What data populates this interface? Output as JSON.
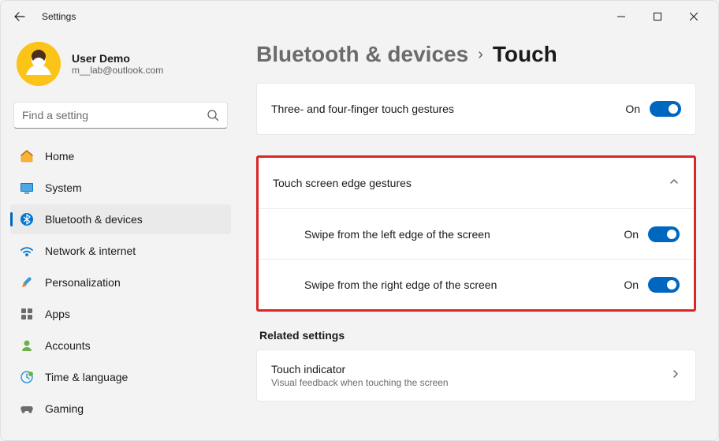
{
  "window": {
    "title": "Settings"
  },
  "profile": {
    "name": "User Demo",
    "email": "m__lab@outlook.com"
  },
  "search": {
    "placeholder": "Find a setting"
  },
  "nav": {
    "home": "Home",
    "system": "System",
    "bluetooth": "Bluetooth & devices",
    "network": "Network & internet",
    "personalization": "Personalization",
    "apps": "Apps",
    "accounts": "Accounts",
    "time": "Time & language",
    "gaming": "Gaming"
  },
  "breadcrumb": {
    "parent": "Bluetooth & devices",
    "current": "Touch"
  },
  "settings": {
    "gestures34": {
      "label": "Three- and four-finger touch gestures",
      "status": "On"
    },
    "edgeGestures": {
      "header": "Touch screen edge gestures",
      "left": {
        "label": "Swipe from the left edge of the screen",
        "status": "On"
      },
      "right": {
        "label": "Swipe from the right edge of the screen",
        "status": "On"
      }
    },
    "relatedHeading": "Related settings",
    "touchIndicator": {
      "label": "Touch indicator",
      "sublabel": "Visual feedback when touching the screen"
    }
  }
}
